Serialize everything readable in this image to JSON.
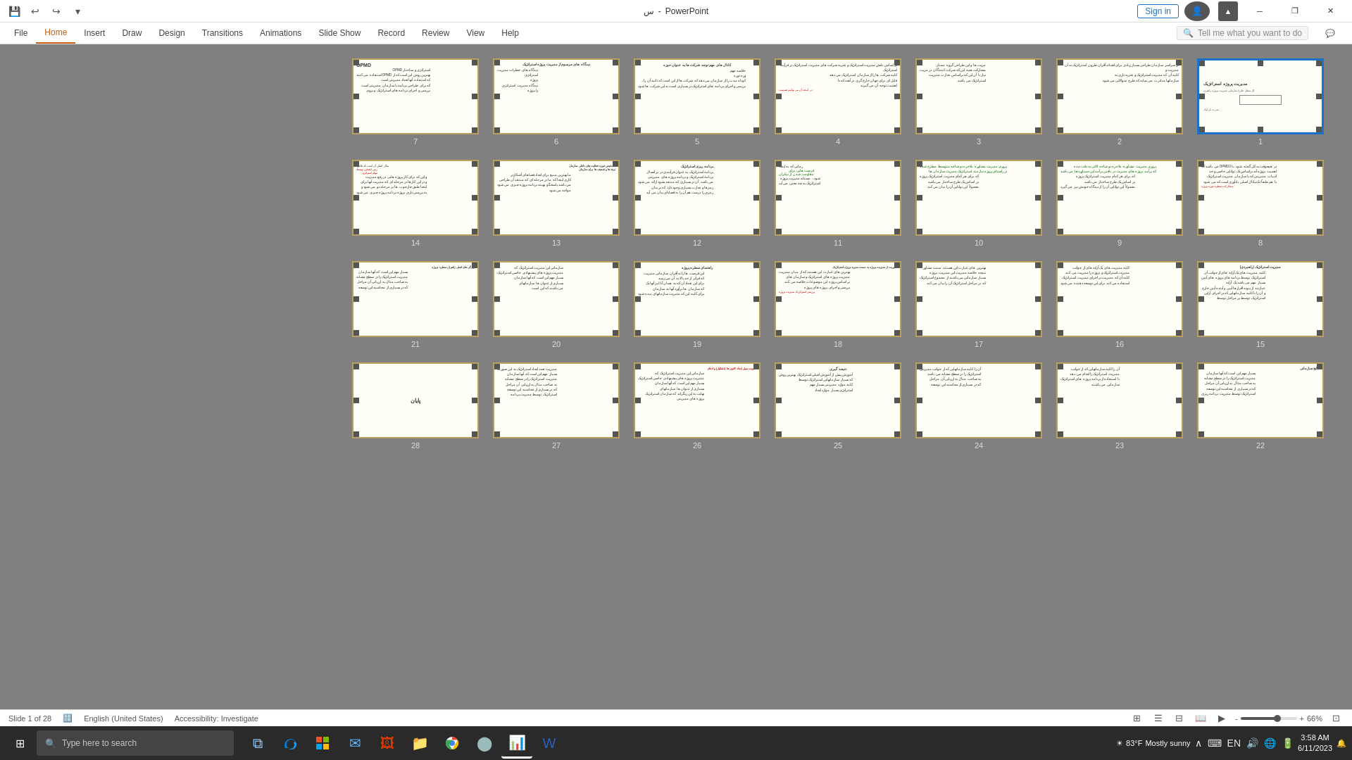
{
  "titleBar": {
    "appName": "PowerPoint",
    "fileName": "س",
    "signIn": "Sign in",
    "quickAccess": [
      "save",
      "undo",
      "redo",
      "customize"
    ],
    "windowControls": [
      "minimize",
      "restore",
      "close"
    ]
  },
  "ribbon": {
    "tabs": [
      "File",
      "Home",
      "Insert",
      "Draw",
      "Design",
      "Transitions",
      "Animations",
      "Slide Show",
      "Record",
      "Review",
      "View",
      "Help"
    ],
    "activeTab": "Home",
    "searchPlaceholder": "Tell me what you want to do"
  },
  "status": {
    "slideInfo": "Slide 1 of 28",
    "language": "English (United States)",
    "accessibility": "Accessibility: Investigate",
    "zoom": "66%",
    "views": [
      "normal",
      "outline",
      "slidesorter",
      "reading",
      "slideshow"
    ]
  },
  "slides": [
    {
      "number": 1,
      "selected": true,
      "title": "مدیریت پروژه استراتژیک",
      "subtitle": "از منظر طرح سازمانی مدیریت پروژه راهبری",
      "hasBox": true
    },
    {
      "number": 2,
      "title": "",
      "content": "در سراسر سازمان طراحی بسیار زیادی برای...",
      "lines": 8
    },
    {
      "number": 3,
      "title": "",
      "content": "مزیت ها در این طراحی...",
      "lines": 7
    },
    {
      "number": 4,
      "title": "",
      "content": "بر اساس دانش مدیریت استراتژیک و تجربه...",
      "lines": 9,
      "hasRed": true
    },
    {
      "number": 5,
      "title": "کانال های مهم توجه ...",
      "content": "",
      "lines": 7
    },
    {
      "number": 6,
      "title": "دیدگاه های مرسوم از مدیریت پروژه استراتژیک",
      "content": "",
      "lines": 7
    },
    {
      "number": 7,
      "title": "OPMD",
      "content": "",
      "lines": 8
    },
    {
      "number": 8,
      "title": "",
      "content": "در هیچوقت به کل گفته شود...",
      "lines": 8,
      "hasRed": true
    },
    {
      "number": 9,
      "title": "",
      "content": "پروری مدیریت مشاوره...",
      "lines": 8,
      "hasGreen": true
    },
    {
      "number": 10,
      "title": "",
      "content": "پروری مدیریت مشاوره...",
      "lines": 8,
      "hasGreen": true
    },
    {
      "number": 11,
      "title": "",
      "content": "رمانی که به اینجا فرصت هایی برای...",
      "lines": 6,
      "hasGreen": true
    },
    {
      "number": 12,
      "title": "برنامه ریزی استراتژیک",
      "content": "",
      "lines": 8
    },
    {
      "number": 13,
      "title": "تشخیص حوزه فعالیت های داخلی سازمان...",
      "content": "",
      "lines": 8,
      "hasRed": true
    },
    {
      "number": 14,
      "title": "مثال اصلی آن است...",
      "content": "",
      "lines": 6,
      "hasRed": true
    },
    {
      "number": 15,
      "title": "مدیریت استراتژیک (راهبردی)",
      "content": "",
      "lines": 8
    },
    {
      "number": 16,
      "title": "",
      "content": "...",
      "lines": 8
    },
    {
      "number": 17,
      "title": "",
      "content": "بهترین های عبارت این...",
      "lines": 8
    },
    {
      "number": 18,
      "title": "مدیریت از مدیریت پروژه به سمت مدیریه پروژه استراتژیک",
      "content": "",
      "lines": 7,
      "hasRed": true
    },
    {
      "number": 19,
      "title": "راهنمای سطره پروژه",
      "content": "",
      "lines": 8
    },
    {
      "number": 20,
      "title": "",
      "content": "...",
      "lines": 7
    },
    {
      "number": 21,
      "title": "ویژگی های اصلی راهبران سطره پروژه",
      "content": "",
      "lines": 8
    },
    {
      "number": 22,
      "title": "نتایج سازمانی",
      "content": "",
      "lines": 8
    },
    {
      "number": 23,
      "title": "",
      "content": "...",
      "lines": 8
    },
    {
      "number": 24,
      "title": "",
      "content": "...",
      "lines": 7
    },
    {
      "number": 25,
      "title": "نتیجه گیری",
      "content": "",
      "lines": 8
    },
    {
      "number": 26,
      "title": "تجویت موثر ایجاد کانون ها (تشکیل) و ادغام",
      "content": "",
      "lines": 8,
      "hasRed": true
    },
    {
      "number": 27,
      "title": "مدیریت تعدد ایجاد استراتژیک...",
      "content": "",
      "lines": 8
    },
    {
      "number": 28,
      "title": "پایان",
      "content": "",
      "isEmpty": true
    }
  ],
  "taskbar": {
    "searchPlaceholder": "Type here to search",
    "apps": [
      {
        "name": "start",
        "icon": "⊞"
      },
      {
        "name": "task-view",
        "icon": "❑"
      },
      {
        "name": "edge",
        "icon": "e"
      },
      {
        "name": "store",
        "icon": "🏪"
      },
      {
        "name": "mail",
        "icon": "✉"
      },
      {
        "name": "photos",
        "icon": "🖼"
      },
      {
        "name": "explorer",
        "icon": "📁"
      },
      {
        "name": "chrome",
        "icon": "⬤"
      },
      {
        "name": "outlook",
        "icon": "📧"
      },
      {
        "name": "powerpoint",
        "icon": "📊",
        "active": true
      },
      {
        "name": "word",
        "icon": "W"
      }
    ],
    "weather": {
      "temp": "83°F",
      "condition": "Mostly sunny"
    },
    "systemIcons": [
      "chevron-up",
      "keyboard",
      "language",
      "volume",
      "network",
      "clock"
    ],
    "time": "3:58 AM",
    "date": "6/11/2023"
  }
}
